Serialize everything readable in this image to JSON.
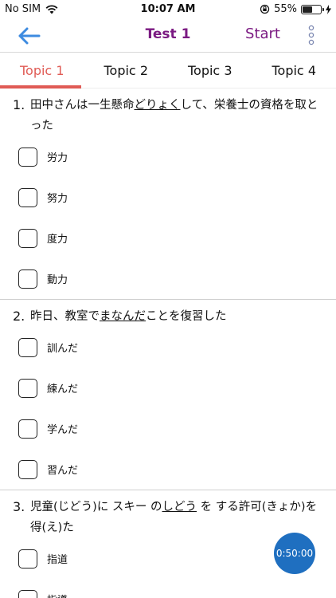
{
  "status": {
    "carrier": "No SIM",
    "time": "10:07 AM",
    "battery_percent": "55%",
    "battery_level": 0.55
  },
  "nav": {
    "title": "Test 1",
    "start_label": "Start",
    "title_color": "#7b1a82"
  },
  "tabs": [
    {
      "label": "Topic 1",
      "active": true
    },
    {
      "label": "Topic 2",
      "active": false
    },
    {
      "label": "Topic 3",
      "active": false
    },
    {
      "label": "Topic 4",
      "active": false
    }
  ],
  "accent_color": "#e05b55",
  "questions": [
    {
      "number": "1.",
      "pre": "田中さんは一生懸命",
      "underlined": "どりょく",
      "post": "して、栄養士の資格を取と った",
      "options": [
        "労力",
        "努力",
        "度力",
        "動力"
      ]
    },
    {
      "number": "2.",
      "pre": "昨日、教室で",
      "underlined": "まなんだ",
      "post": "ことを復習した",
      "options": [
        "訓んだ",
        "練んだ",
        "学んだ",
        "習んだ"
      ]
    },
    {
      "number": "3.",
      "pre": "児童(じどう)に スキー の",
      "underlined": "しどう",
      "post": " を する許可(きょか)を得(え)た",
      "options": [
        "指道",
        "指導"
      ]
    }
  ],
  "timer": {
    "label": "0:50:00",
    "color": "#1f6fc0"
  }
}
